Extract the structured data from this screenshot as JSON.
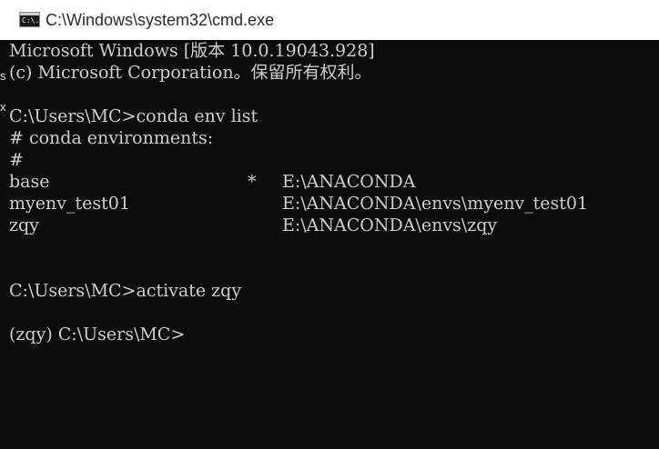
{
  "window": {
    "title": "C:\\Windows\\system32\\cmd.exe",
    "icon": "console-icon",
    "icon_label": "C:\\."
  },
  "side_fragments": [
    "s",
    "x"
  ],
  "console": {
    "lines": [
      "Microsoft Windows [版本 10.0.19043.928]",
      "(c) Microsoft Corporation。保留所有权利。",
      "",
      "C:\\Users\\MC>conda env list",
      "# conda environments:",
      "#",
      "",
      "",
      "",
      "",
      "",
      "C:\\Users\\MC>activate zqy",
      "",
      "(zqy) C:\\Users\\MC>"
    ],
    "environments": [
      {
        "name": "base",
        "marker": "*",
        "path": "E:\\ANACONDA"
      },
      {
        "name": "myenv_test01",
        "marker": "",
        "path": "E:\\ANACONDA\\envs\\myenv_test01"
      },
      {
        "name": "zqy",
        "marker": "",
        "path": "E:\\ANACONDA\\envs\\zqy"
      }
    ]
  }
}
